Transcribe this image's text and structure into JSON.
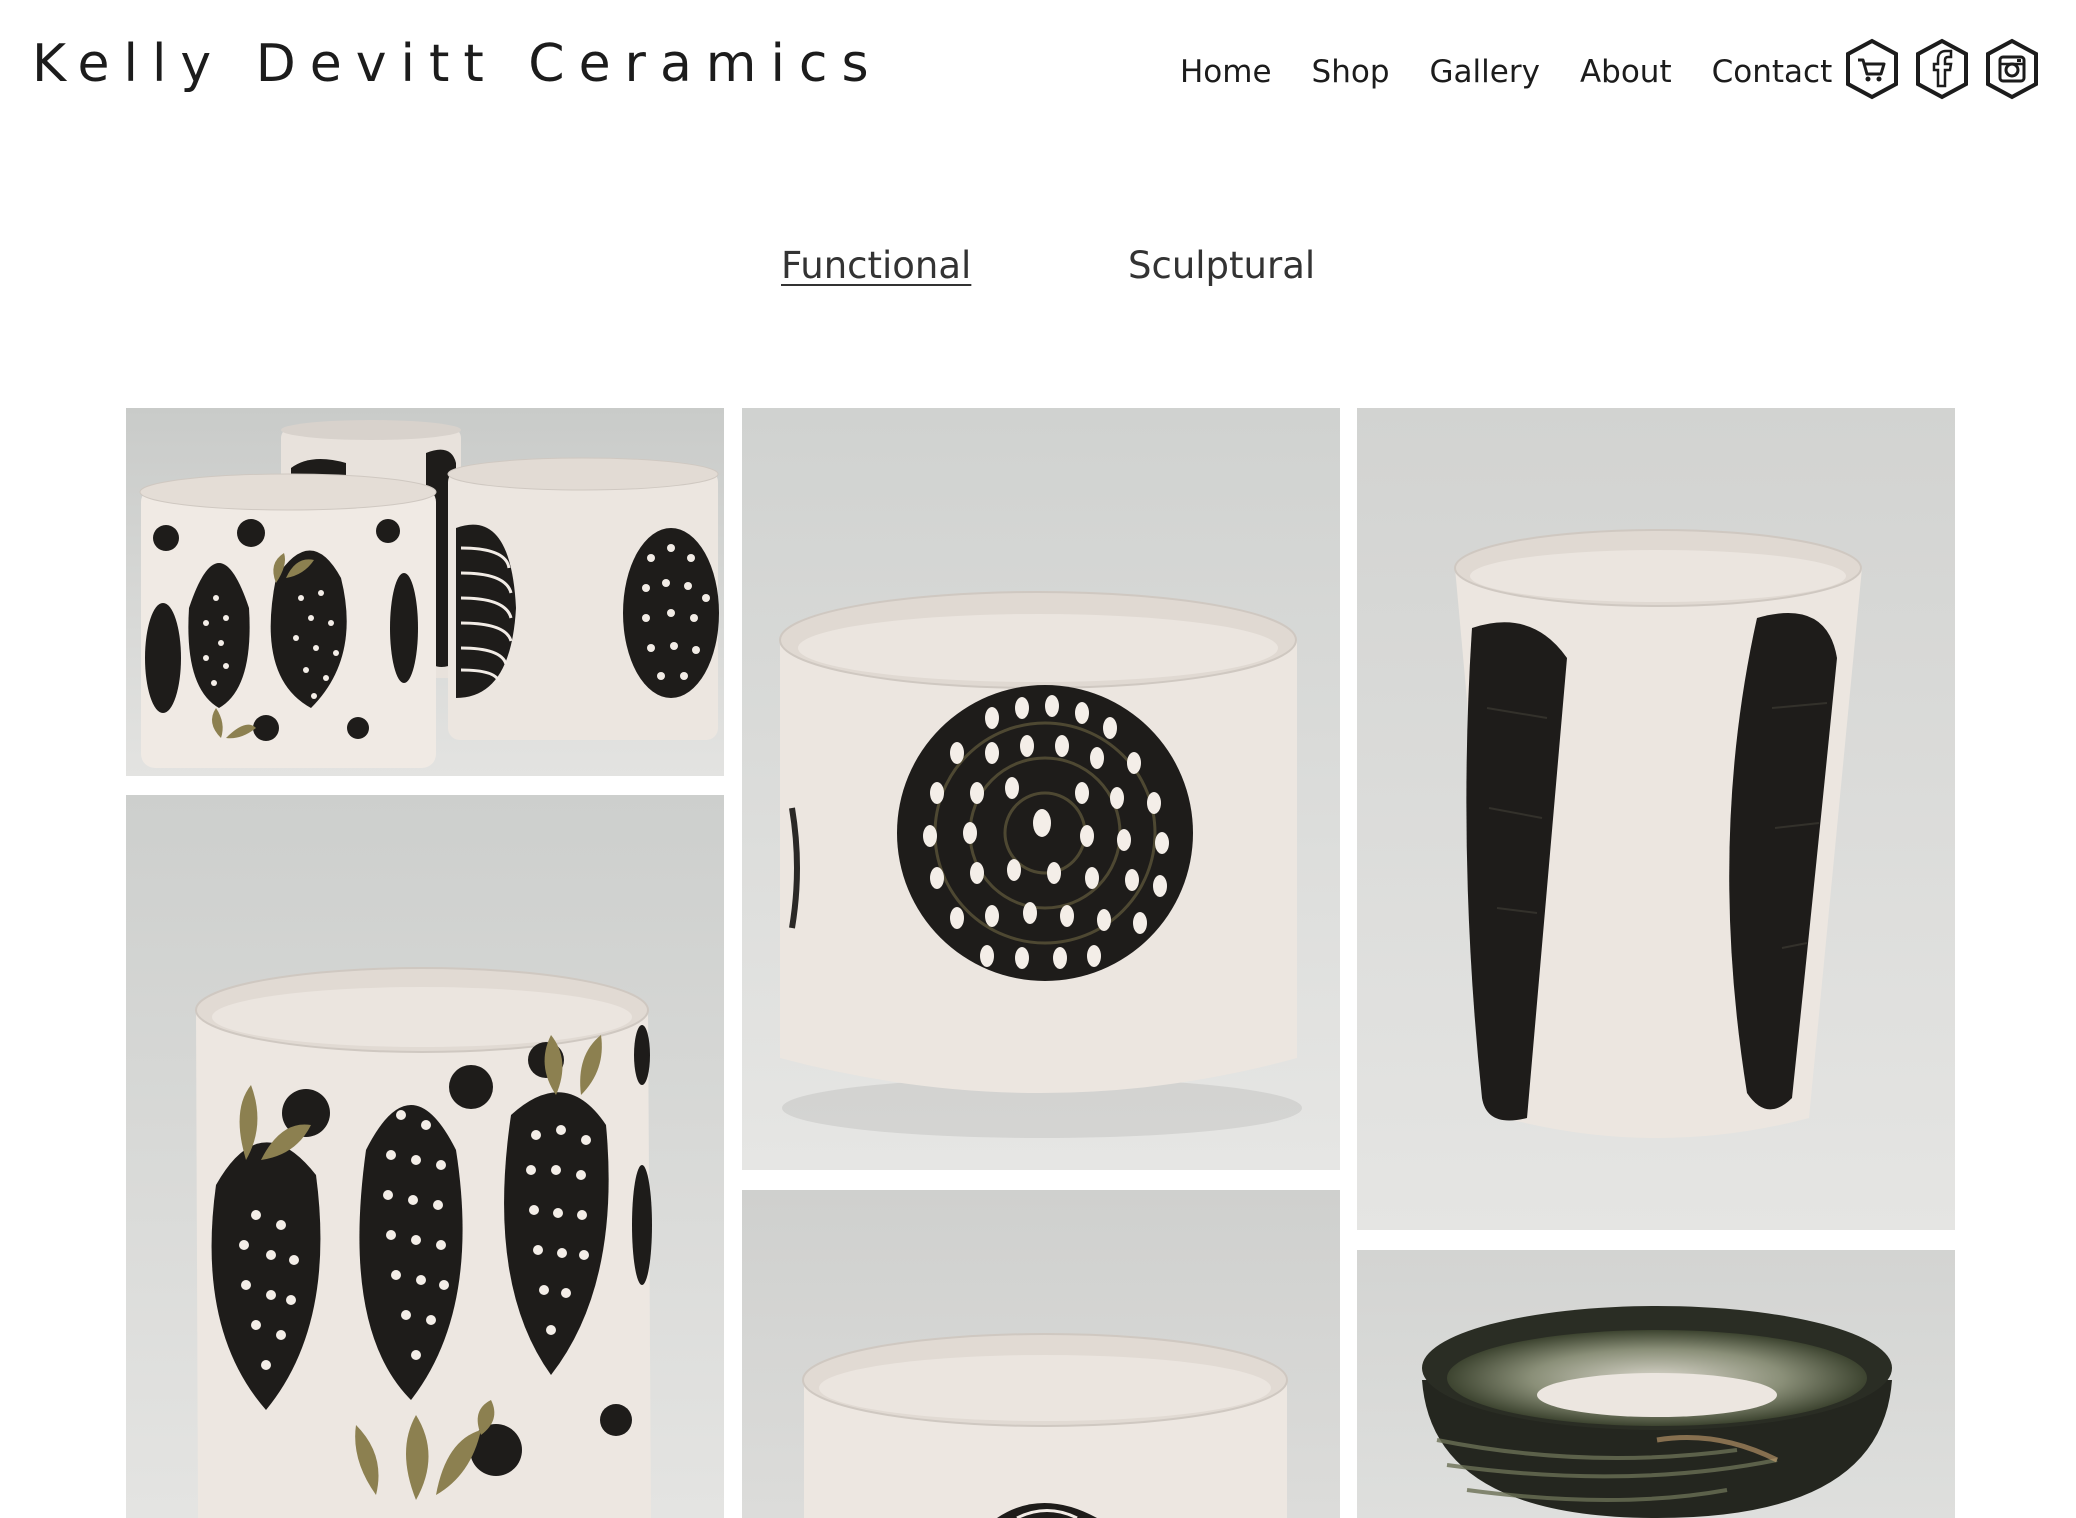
{
  "header": {
    "site_title": "Kelly Devitt Ceramics",
    "nav": [
      "Home",
      "Shop",
      "Gallery",
      "About",
      "Contact"
    ],
    "social_icons": [
      "cart-icon",
      "facebook-icon",
      "instagram-icon"
    ]
  },
  "categories": {
    "items": [
      "Functional",
      "Sculptural"
    ],
    "active": "Functional"
  },
  "gallery": {
    "items": [
      {
        "name": "three-strawberry-cups-photo"
      },
      {
        "name": "dotted-spiral-cup-photo"
      },
      {
        "name": "black-stroke-tumbler-photo"
      },
      {
        "name": "strawberry-cup-closeup-photo"
      },
      {
        "name": "white-cup-photo"
      },
      {
        "name": "dark-glaze-bowl-photo"
      }
    ]
  },
  "colors": {
    "clay": "#ece6e0",
    "slip": "#1e1c1a",
    "background": "#d6d7d5",
    "glaze_green": "#3d4430",
    "leaf": "#8c8050"
  }
}
